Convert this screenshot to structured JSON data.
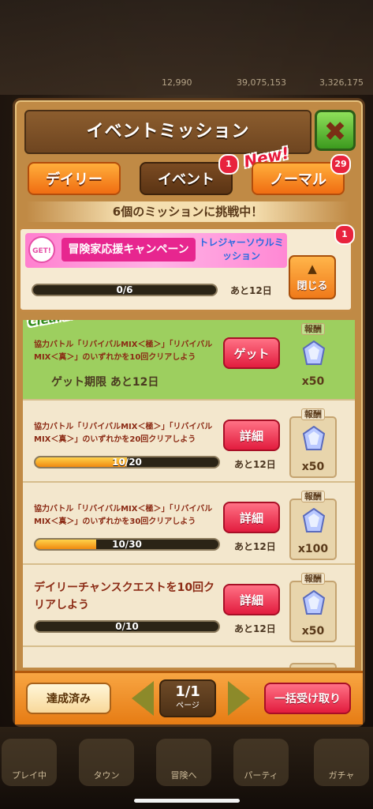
{
  "header": {
    "title": "イベントミッション"
  },
  "tabs": [
    {
      "label": "デイリー"
    },
    {
      "label": "イベント",
      "badge": "1"
    },
    {
      "label": "ノーマル",
      "badge": "29",
      "tag": "New!"
    }
  ],
  "subtitle": "6個のミッションに挑戦中！",
  "campaign": {
    "get_label": "GET!",
    "title": "冒険家応援キャンペーン",
    "subtitle": "トレジャーソウルミッション",
    "badge": "1",
    "progress_text": "0/6",
    "progress_fraction": 0,
    "remaining": "あと12日",
    "close_label": "閉じる"
  },
  "missions": [
    {
      "cleared": true,
      "cleared_tag": "Cleared!",
      "description": "協力バトル「リバイバルMIX＜極＞」「リバイバルMIX＜真＞」のいずれかを10回クリアしよう",
      "button": "ゲット",
      "deadline": "ゲット期限 あと12日",
      "reward_label": "報酬",
      "reward_count": "x50"
    },
    {
      "cleared": false,
      "description": "協力バトル「リバイバルMIX＜極＞」「リバイバルMIX＜真＞」のいずれかを20回クリアしよう",
      "button": "詳細",
      "progress_text": "10/20",
      "progress_fraction": 0.5,
      "remaining": "あと12日",
      "reward_label": "報酬",
      "reward_count": "x50"
    },
    {
      "cleared": false,
      "description": "協力バトル「リバイバルMIX＜極＞」「リバイバルMIX＜真＞」のいずれかを30回クリアしよう",
      "button": "詳細",
      "progress_text": "10/30",
      "progress_fraction": 0.333,
      "remaining": "あと12日",
      "reward_label": "報酬",
      "reward_count": "x100"
    },
    {
      "cleared": false,
      "description": "デイリーチャンスクエストを10回クリアしよう",
      "button": "詳細",
      "progress_text": "0/10",
      "progress_fraction": 0,
      "remaining": "あと12日",
      "reward_label": "報酬",
      "reward_count": "x50"
    }
  ],
  "footer": {
    "done_label": "達成済み",
    "page": "1/1",
    "page_label": "ページ",
    "receive_all_label": "一括受け取り"
  },
  "background": {
    "hud": [
      "12,990",
      "39,075,153",
      "3,326,175"
    ],
    "nav": [
      "プレイ中",
      "タウン",
      "冒険へ",
      "パーティ",
      "ガチャ"
    ]
  }
}
